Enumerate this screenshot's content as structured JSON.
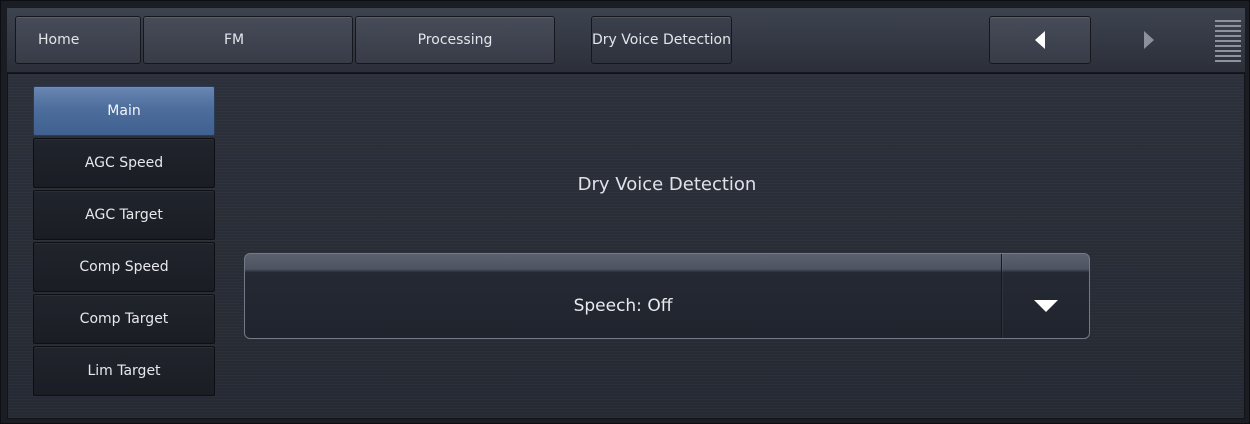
{
  "topbar": {
    "tabs": [
      {
        "label": "Home"
      },
      {
        "label": "FM"
      },
      {
        "label": "Processing"
      }
    ],
    "current_page": "Dry Voice Detection"
  },
  "sidebar": {
    "items": [
      {
        "label": "Main",
        "active": true
      },
      {
        "label": "AGC Speed",
        "active": false
      },
      {
        "label": "AGC Target",
        "active": false
      },
      {
        "label": "Comp Speed",
        "active": false
      },
      {
        "label": "Comp Target",
        "active": false
      },
      {
        "label": "Lim Target",
        "active": false
      }
    ]
  },
  "main": {
    "section_title": "Dry Voice Detection",
    "speech_select": {
      "value": "Speech: Off"
    }
  },
  "colors": {
    "accent": "#4d6d9c",
    "background": "#262a33",
    "text": "#e3e5e9"
  },
  "icons": {
    "back": "left-triangle-icon",
    "forward": "right-triangle-icon",
    "menu": "menu-grip-icon",
    "dropdown": "chevron-down-icon"
  }
}
